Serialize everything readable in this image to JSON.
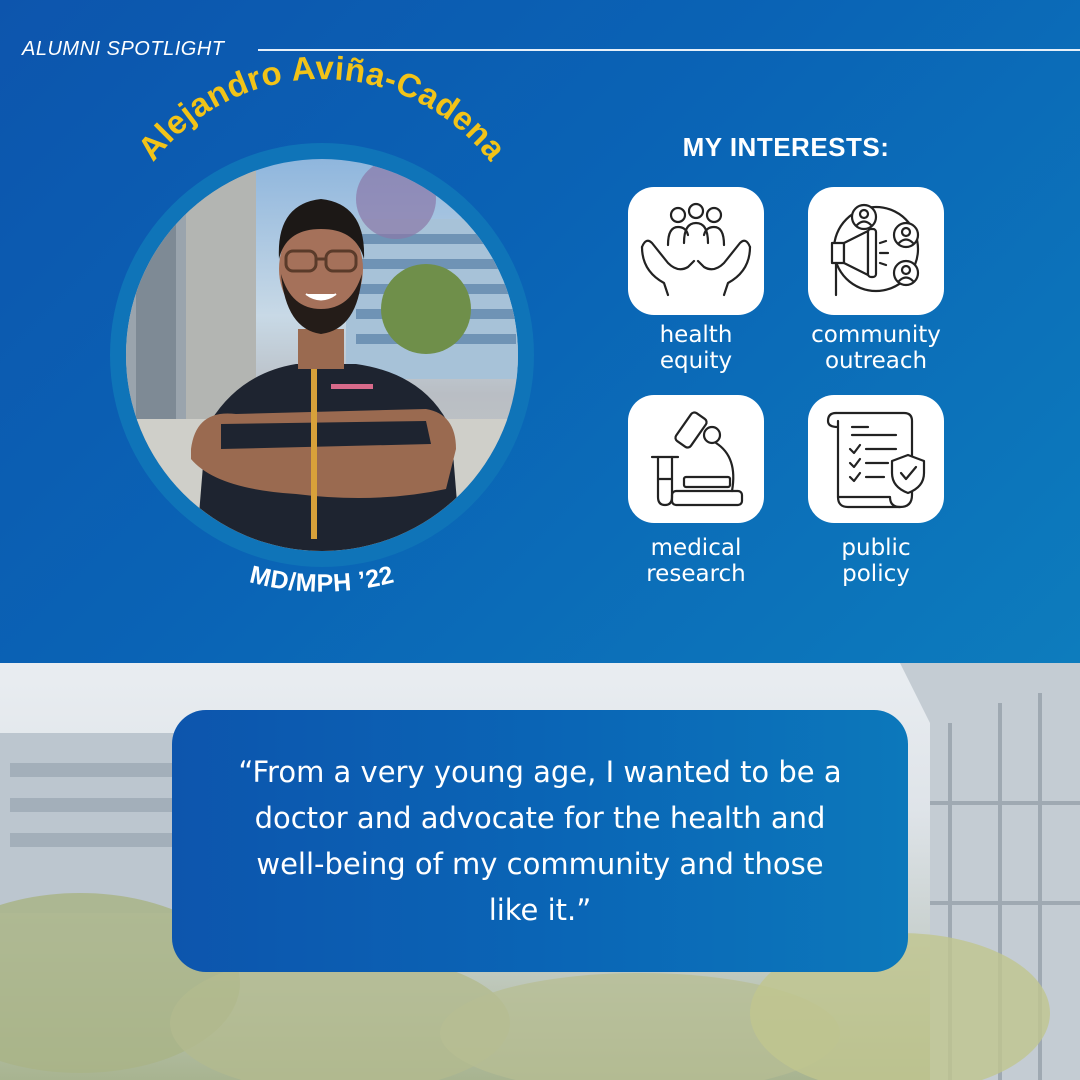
{
  "header": {
    "eyebrow": "ALUMNI SPOTLIGHT"
  },
  "profile": {
    "name": "Alejandro Aviña-Cadena",
    "degree": "MD/MPH ’22"
  },
  "interests": {
    "title": "MY INTERESTS:",
    "items": [
      {
        "line1": "health",
        "line2": "equity",
        "icon": "hands-people-icon"
      },
      {
        "line1": "community",
        "line2": "outreach",
        "icon": "megaphone-network-icon"
      },
      {
        "line1": "medical",
        "line2": "research",
        "icon": "microscope-icon"
      },
      {
        "line1": "public",
        "line2": "policy",
        "icon": "policy-scroll-icon"
      }
    ]
  },
  "quote": {
    "text": "“From a very young age, I wanted to be a doctor and advocate for the health and well-being of my community and those like it.”"
  },
  "colors": {
    "brand_blue": "#0a63b5",
    "name_gold": "#f2c318",
    "white": "#ffffff"
  }
}
